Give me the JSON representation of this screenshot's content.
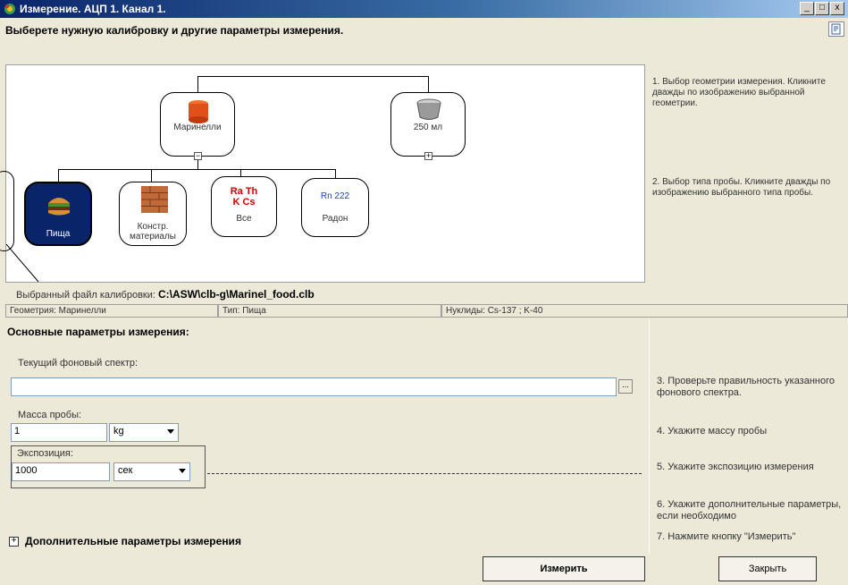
{
  "window": {
    "title": "Измерение. АЦП 1. Канал 1.",
    "minimize": "_",
    "maximize": "□",
    "close": "x"
  },
  "header": {
    "instruction": "Выберете нужную калибровку и другие параметры измерения."
  },
  "geometry": {
    "nodes": [
      {
        "label": "Маринелли",
        "icon": "red-marinelli-icon",
        "toggle": "−"
      },
      {
        "label": "250 мл",
        "icon": "gray-container-icon",
        "toggle": "+"
      }
    ]
  },
  "sample_types": {
    "items": [
      {
        "label": "Пища",
        "icon": "burger-icon",
        "selected": true
      },
      {
        "label": "Констр. материалы",
        "icon": "brick-wall-icon",
        "selected": false
      },
      {
        "label": "Все",
        "icon": "nuclides-icon",
        "text_top": "Ra Th",
        "text_bottom": "K Cs",
        "selected": false
      },
      {
        "label": "Радон",
        "icon": "radon-icon",
        "text_top": "Rn 222",
        "selected": false
      }
    ]
  },
  "hints_top": [
    "1. Выбор геометрии измерения. Кликните дважды по изображению выбранной геометрии.",
    "2. Выбор типа пробы. Кликните дважды по изображению выбранного типа пробы."
  ],
  "calibration": {
    "file_label": "Выбранный файл калибровки:",
    "file_path": "C:\\ASW\\clb-g\\Marinel_food.clb",
    "geometry": "Геометрия: Маринелли",
    "type": "Тип: Пища",
    "nuclides": "Нуклиды: Cs-137 ; K-40"
  },
  "main": {
    "section_title": "Основные параметры измерения:",
    "background_label": "Текущий фоновый спектр:",
    "background_value": "",
    "browse": "...",
    "mass_label": "Масса пробы:",
    "mass_value": "1",
    "mass_unit": "kg",
    "exposure_label": "Экспозиция:",
    "exposure_value": "1000",
    "exposure_unit": "сек",
    "expander": "+",
    "extra_params": "Дополнительные параметры измерения"
  },
  "hints_main": [
    "3. Проверьте правильность указанного фонового спектра.",
    "4. Укажите массу пробы",
    "5. Укажите экспозицию измерения",
    "6. Укажите дополнительные параметры, если необходимо",
    "7. Нажмите кнопку \"Измерить\""
  ],
  "buttons": {
    "measure": "Измерить",
    "close": "Закрыть"
  },
  "colors": {
    "selected_node": "#0a246a",
    "title_bar": "#0a246a",
    "nuclide_text": "#d00000",
    "radon_text": "#2040c0"
  }
}
